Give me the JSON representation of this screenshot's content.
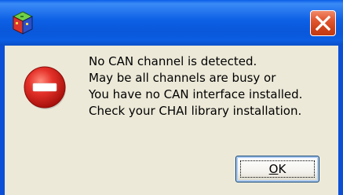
{
  "titlebar": {
    "title": "",
    "app_icon": "application-icon",
    "close_icon": "close-icon"
  },
  "dialog": {
    "icon": "error-icon",
    "message_lines": [
      "No CAN channel is detected.",
      "May be all channels are busy or",
      "You have no CAN interface installed.",
      "Check your CHAI library installation."
    ],
    "ok_button": {
      "mnemonic": "O",
      "rest": "K"
    }
  },
  "colors": {
    "titlebar": "#0a57da",
    "close_button": "#d0431b",
    "dialog_face": "#ece9d8",
    "error_red": "#d8201c"
  }
}
